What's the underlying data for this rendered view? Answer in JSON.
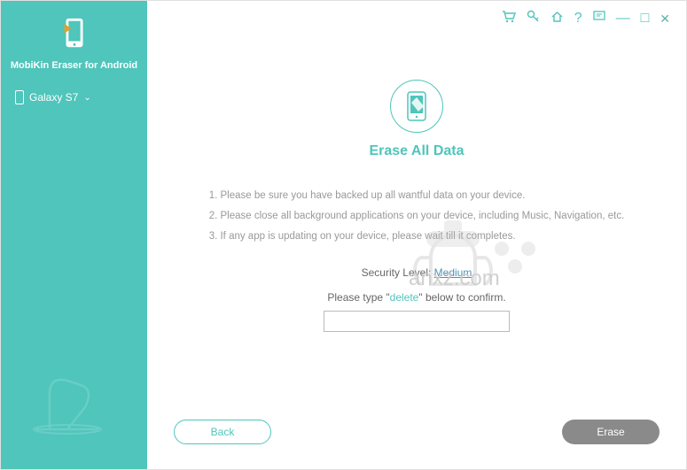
{
  "sidebar": {
    "app_name": "MobiKin Eraser for Android",
    "device_label": "Galaxy S7"
  },
  "titlebar": {
    "cart": "cart-icon",
    "key": "key-icon",
    "home": "home-icon",
    "help": "?",
    "feedback": "feedback-icon",
    "min": "—",
    "max": "□",
    "close": "✕"
  },
  "main": {
    "title": "Erase All Data",
    "instructions": {
      "line1": "1. Please be sure you have backed up all wantful data on your device.",
      "line2": "2. Please close all background applications on your device, including Music, Navigation, etc.",
      "line3": "3. If any app is updating on your device, please wait till it completes."
    },
    "security_label": "Security Level:",
    "security_value": "Medium",
    "type_prefix": "Please type \"",
    "type_keyword": "delete",
    "type_suffix": "\" below to confirm.",
    "confirm_value": ""
  },
  "footer": {
    "back": "Back",
    "erase": "Erase"
  },
  "watermark": {
    "text": "anxz.com"
  }
}
